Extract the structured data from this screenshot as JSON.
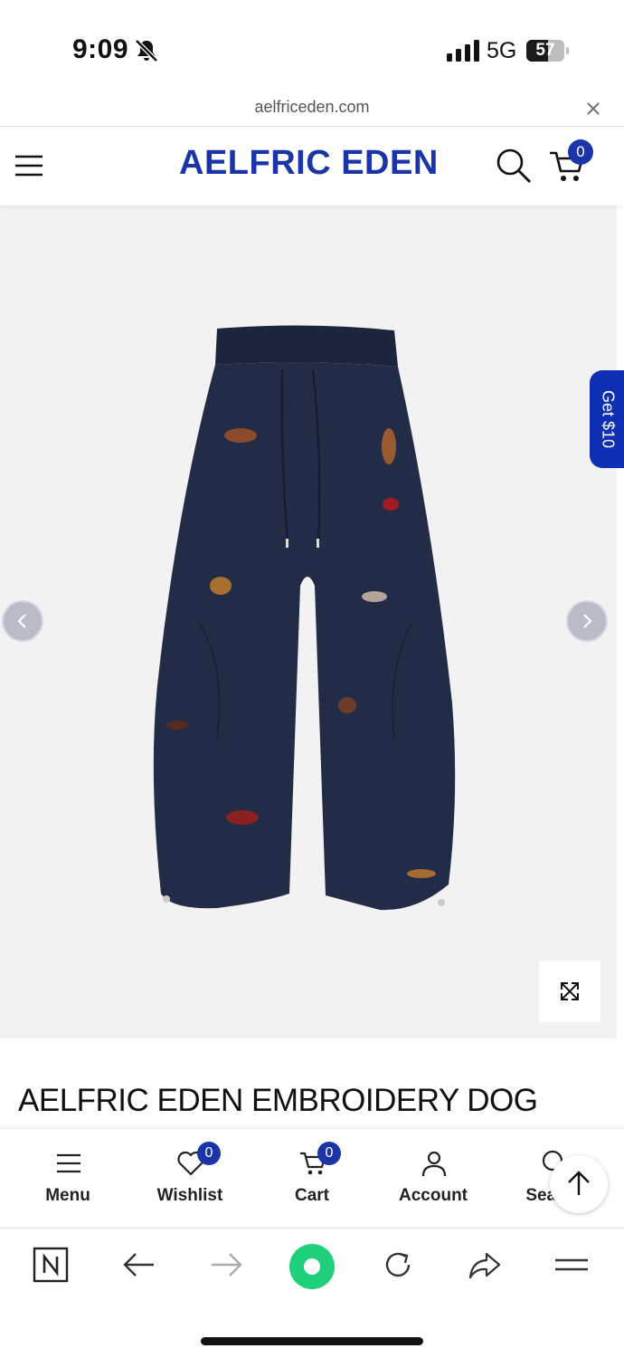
{
  "status_bar": {
    "time": "9:09",
    "network": "5G",
    "battery": "57",
    "battery_level": 0.57
  },
  "browser": {
    "url": "aelfriceden.com"
  },
  "header": {
    "brand": "AELFRIC EDEN",
    "cart_count": "0"
  },
  "promo": {
    "label": "Get $10"
  },
  "product": {
    "title": "AELFRIC EDEN EMBROIDERY DOG"
  },
  "bottom_nav": {
    "items": [
      {
        "label": "Menu",
        "icon": "menu-icon"
      },
      {
        "label": "Wishlist",
        "icon": "heart-icon",
        "badge": "0"
      },
      {
        "label": "Cart",
        "icon": "cart-icon",
        "badge": "0"
      },
      {
        "label": "Account",
        "icon": "user-icon"
      },
      {
        "label": "Search",
        "icon": "search-icon"
      }
    ]
  },
  "colors": {
    "brand": "#1b35a8",
    "promo": "#0f2fb5",
    "reader": "#1ed07a",
    "pants": "#232c46"
  }
}
